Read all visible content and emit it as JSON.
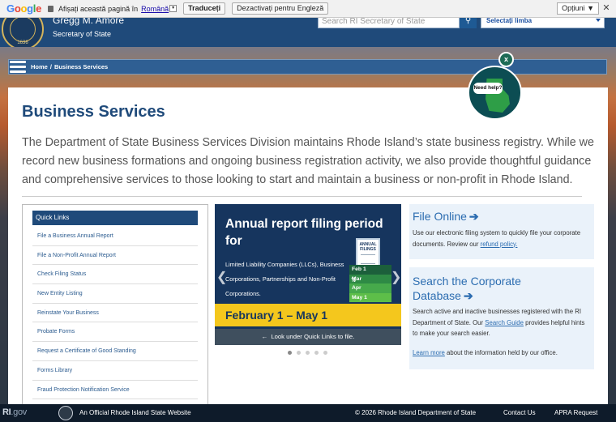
{
  "translate_bar": {
    "brand": "Google",
    "prompt": "Afișați această pagină în",
    "language": "Română",
    "translate_button": "Traduceți",
    "disable_button": "Dezactivați pentru Engleză",
    "options_button": "Opțiuni ▼",
    "close_icon": "close-icon"
  },
  "header": {
    "official_name": "Gregg M. Amore",
    "official_title": "Secretary of State",
    "seal_year": "1636",
    "search_placeholder": "Search RI Secretary of State",
    "language_select": "Selectați limba",
    "background_color": "#1f4a7a"
  },
  "breadcrumb": {
    "home": "Home",
    "separator": "/",
    "current": "Business Services"
  },
  "help_widget": {
    "close": "x",
    "label": "Need help?"
  },
  "main": {
    "title": "Business Services",
    "intro": "The Department of State Business Services Division maintains Rhode Island’s state business registry. While we record new business formations and ongoing business registration activity, we also provide thoughtful guidance and comprehensive services to those looking to start and maintain a business or non-profit in Rhode Island."
  },
  "quick_links": {
    "heading": "Quick Links",
    "items": [
      "File a Business Annual Report",
      "File a Non-Profit Annual Report",
      "Check Filing Status",
      "New Entity Listing",
      "Reinstate Your Business",
      "Probate Forms",
      "Request a Certificate of Good Standing",
      "Forms Library",
      "Fraud Protection Notification Service"
    ]
  },
  "carousel": {
    "title": "Annual report filing period for",
    "subtitle": "Limited Liability Companies (LLCs), Business Corporations, Partnerships and Non-Profit Corporations.",
    "doc_label": "ANNUAL FILINGS",
    "months": [
      "Feb 1",
      "Mar",
      "Apr",
      "May 1"
    ],
    "date_range": "February 1 – May 1",
    "caption": "Look under Quick Links to file.",
    "slide_count": 5,
    "active_slide": 1,
    "band_color": "#f4c71d"
  },
  "file_online": {
    "title": "File Online",
    "text_before": "Use our electronic filing system to quickly file your corporate documents. Review our",
    "link": "refund policy.",
    "text_after": ""
  },
  "search_corporate": {
    "title": "Search the Corporate Database",
    "text1": "Search active and inactive businesses registered with the RI Department of State. Our",
    "link1": "Search Guide",
    "text2": "provides helpful hints to make your search easier.",
    "link2": "Learn more",
    "text3": "about the information held by our office."
  },
  "footer": {
    "logo_ri": "RI",
    "logo_gov": ".gov",
    "official": "An Official Rhode Island State Website",
    "copyright": "© 2026 Rhode Island Department of State",
    "contact": "Contact Us",
    "apra": "APRA Request"
  }
}
